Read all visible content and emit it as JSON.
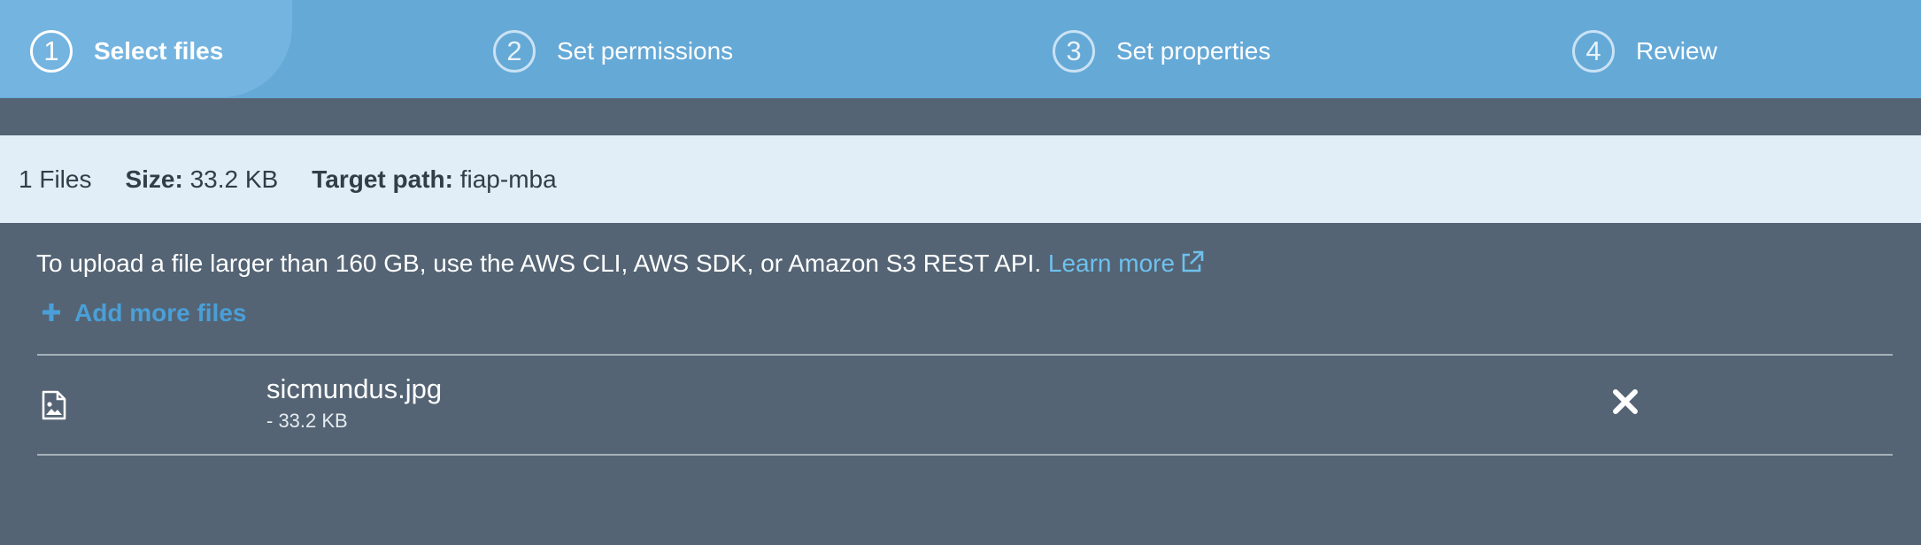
{
  "steps": [
    {
      "number": "1",
      "label": "Select files",
      "active": true
    },
    {
      "number": "2",
      "label": "Set permissions",
      "active": false
    },
    {
      "number": "3",
      "label": "Set properties",
      "active": false
    },
    {
      "number": "4",
      "label": "Review",
      "active": false
    }
  ],
  "summary": {
    "files": "1 Files",
    "size_label": "Size:",
    "size_value": "33.2 KB",
    "target_label": "Target path:",
    "target_value": "fiap-mba"
  },
  "notice": {
    "text": "To upload a file larger than 160 GB, use the AWS CLI, AWS SDK, or Amazon S3 REST API.",
    "link": "Learn more",
    "link_icon": "external-link-icon"
  },
  "add_more": {
    "label": "Add more files",
    "icon": "plus-icon"
  },
  "files": [
    {
      "name": "sicmundus.jpg",
      "size": "- 33.2 KB",
      "icon": "image-file-icon"
    }
  ],
  "colors": {
    "header_bg": "#65a9d7",
    "page_bg": "#546474",
    "summary_bg": "#e1eef7",
    "link": "#6ec1ee",
    "add_more": "#4a9fd8"
  }
}
